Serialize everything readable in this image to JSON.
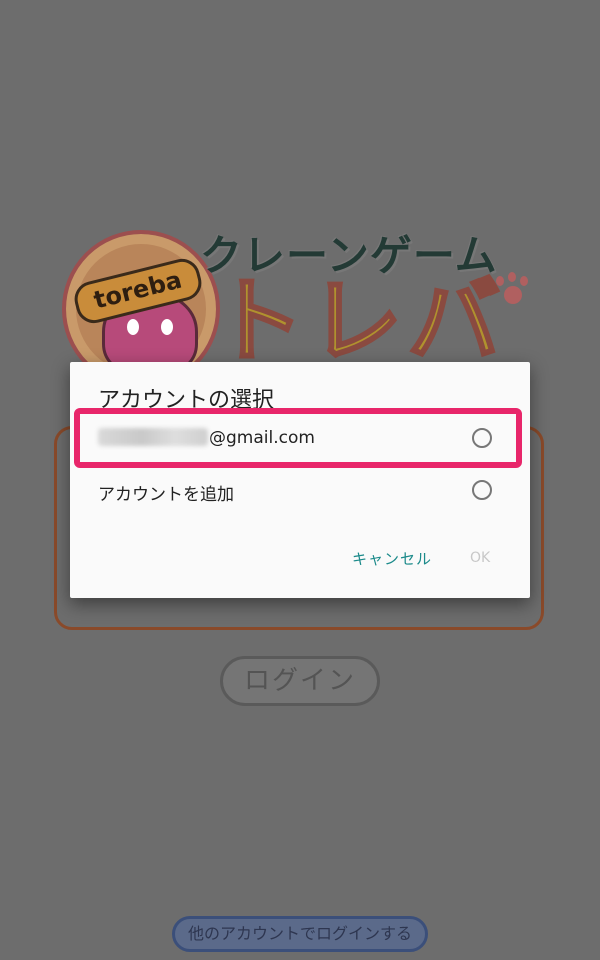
{
  "background": {
    "logo_title": "クレーンゲーム",
    "logo_kana": "トレバ",
    "logo_badge": "toreba",
    "login_button": "ログイン",
    "other_account_button": "他のアカウントでログインする"
  },
  "dialog": {
    "title": "アカウントの選択",
    "options": [
      {
        "label_suffix": "@gmail.com",
        "selected": false
      },
      {
        "label": "アカウントを追加",
        "selected": false
      }
    ],
    "cancel": "キャンセル",
    "ok": "OK"
  },
  "colors": {
    "highlight": "#e8266a",
    "accent": "#1b8a8a"
  }
}
